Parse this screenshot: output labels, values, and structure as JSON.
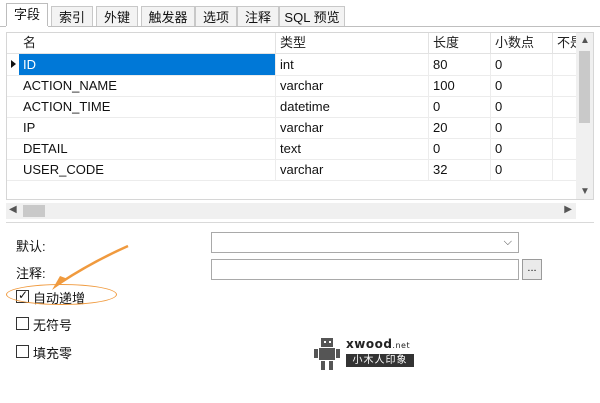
{
  "tabs": [
    "字段",
    "索引",
    "外键",
    "触发器",
    "选项",
    "注释",
    "SQL 预览"
  ],
  "table": {
    "columns": [
      "名",
      "类型",
      "长度",
      "小数点",
      "不是"
    ],
    "rows": [
      {
        "name": "ID",
        "type": "int",
        "length": "80",
        "decimals": "0"
      },
      {
        "name": "ACTION_NAME",
        "type": "varchar",
        "length": "100",
        "decimals": "0"
      },
      {
        "name": "ACTION_TIME",
        "type": "datetime",
        "length": "0",
        "decimals": "0"
      },
      {
        "name": "IP",
        "type": "varchar",
        "length": "20",
        "decimals": "0"
      },
      {
        "name": "DETAIL",
        "type": "text",
        "length": "0",
        "decimals": "0"
      },
      {
        "name": "USER_CODE",
        "type": "varchar",
        "length": "32",
        "decimals": "0"
      }
    ]
  },
  "props": {
    "default_label": "默认:",
    "default_value": "",
    "comment_label": "注释:",
    "comment_value": "",
    "ellipsis": "...",
    "auto_increment": {
      "label": "自动递增",
      "checked": true
    },
    "unsigned": {
      "label": "无符号",
      "checked": false
    },
    "zerofill": {
      "label": "填充零",
      "checked": false
    }
  },
  "watermark": {
    "brand": "xwood",
    "brand_suffix": ".net",
    "subtitle": "小木人印象"
  },
  "colors": {
    "selection": "#0078d7",
    "annotation": "#f09a3e"
  },
  "icons": {
    "check": "✓",
    "row_indicator": "triangle-right",
    "combo_arrow": "chevron-down"
  }
}
